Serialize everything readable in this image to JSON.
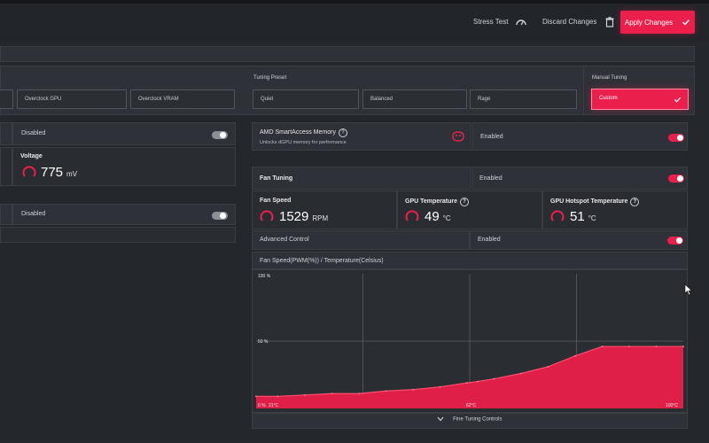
{
  "header": {
    "stress_test": "Stress Test",
    "discard": "Discard Changes",
    "apply": "Apply Changes"
  },
  "tuning": {
    "overclock_gpu": "Overclock GPU",
    "overclock_vram": "Overclock VRAM",
    "preset_label": "Tuning Preset",
    "presets": [
      "Quiet",
      "Balanced",
      "Rage"
    ],
    "manual_label": "Manual Tuning",
    "manual_value": "Custom"
  },
  "left": {
    "disabled1": "Disabled",
    "voltage_title": "Voltage",
    "voltage_value": "775",
    "voltage_unit": "mV",
    "disabled2": "Disabled"
  },
  "sam": {
    "title": "AMD SmartAccess Memory",
    "subtitle": "Unlocks dGPU memory for performance",
    "status": "Enabled"
  },
  "fan": {
    "title": "Fan Tuning",
    "status": "Enabled",
    "speed_title": "Fan Speed",
    "speed_value": "1529",
    "speed_unit": "RPM",
    "gpu_temp_title": "GPU Temperature",
    "gpu_temp_value": "49",
    "gpu_temp_unit": "°C",
    "hotspot_title": "GPU Hotspot Temperature",
    "hotspot_value": "51",
    "hotspot_unit": "°C",
    "advanced_label": "Advanced Control",
    "advanced_status": "Enabled",
    "chart_title": "Fan Speed(PWM(%)) / Temperature(Celsius)",
    "fine_tuning": "Fine Tuning Controls"
  },
  "colors": {
    "accent": "#ea1f4b",
    "background": "#24272c",
    "panel": "#2e3137"
  },
  "chart_data": {
    "type": "area",
    "x": [
      21,
      25,
      30,
      35,
      40,
      45,
      50,
      55,
      60,
      62,
      65,
      70,
      75,
      80,
      85,
      90,
      95,
      100
    ],
    "y": [
      9,
      9,
      10,
      11,
      11,
      13,
      14,
      16,
      19,
      20,
      22,
      26,
      31,
      39,
      46,
      46,
      46,
      46
    ],
    "xlim": [
      21,
      100
    ],
    "ylim": [
      0,
      100
    ],
    "y_ticks": [
      "0 %",
      "50 %",
      "100 %"
    ],
    "x_ticks": [
      "21°C",
      "62°C",
      "100°C"
    ],
    "grid": true
  }
}
